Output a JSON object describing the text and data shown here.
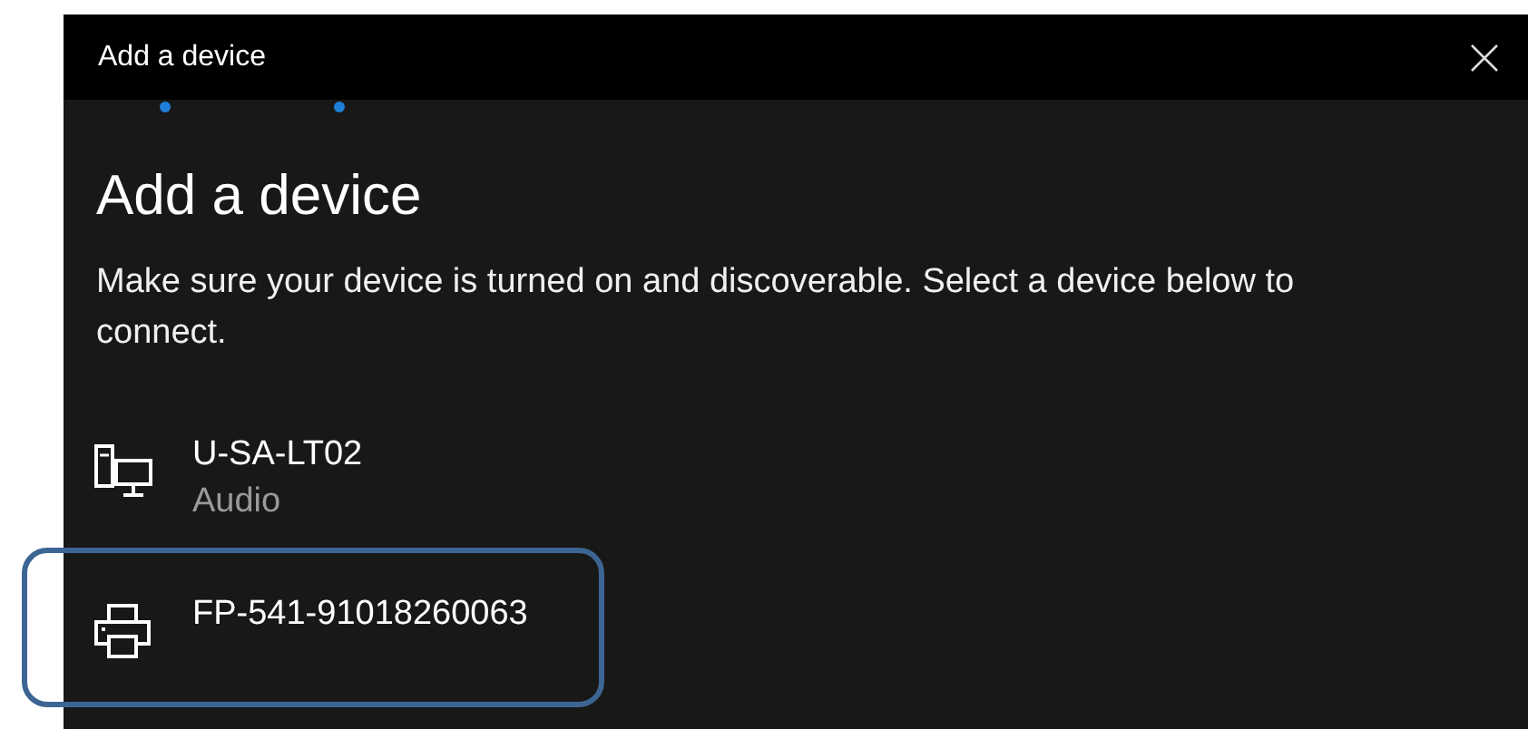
{
  "window": {
    "title": "Add a device"
  },
  "heading": "Add a device",
  "description": "Make sure your device is turned on and discoverable. Select a device below to connect.",
  "devices": [
    {
      "kind": "computer",
      "name": "U-SA-LT02",
      "subtitle": "Audio",
      "highlighted": false
    },
    {
      "kind": "printer",
      "name": "FP-541-91018260063",
      "highlighted": true
    }
  ]
}
